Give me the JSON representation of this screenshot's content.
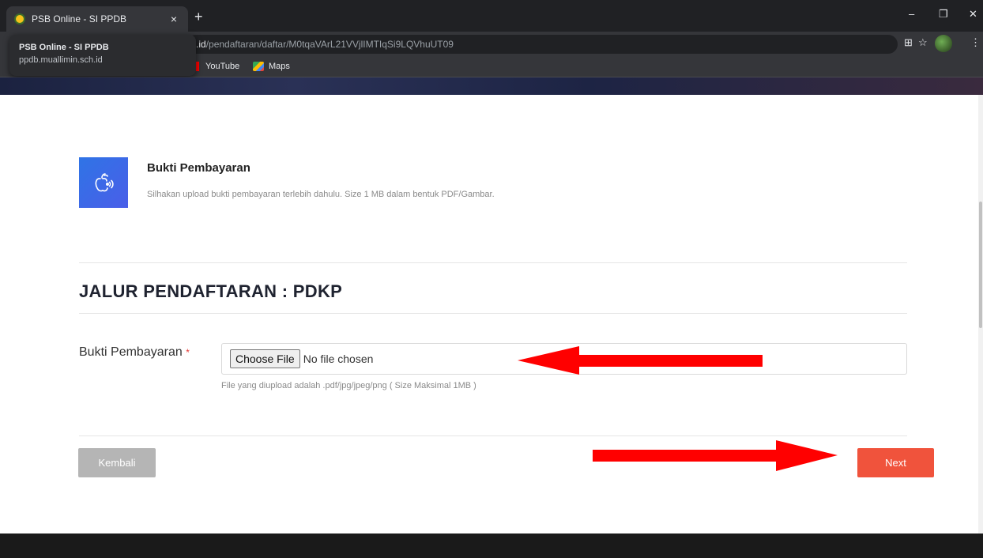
{
  "browser": {
    "tab_title": "PSB Online - SI PPDB",
    "tab_close": "×",
    "new_tab": "+",
    "url_host": ".id",
    "url_path": "/pendaftaran/daftar/M0tqaVArL21VVjlIMTIqSi9LQVhuUT09",
    "hover_card_title": "PSB Online - SI PPDB",
    "hover_card_domain": "ppdb.muallimin.sch.id",
    "bookmarks": [
      "YouTube",
      "Maps"
    ],
    "icons": {
      "minimize": "–",
      "restore": "❐",
      "close": "✕",
      "translate": "⊞",
      "star": "☆",
      "menu": "⋮"
    }
  },
  "step": {
    "title": "Bukti Pembayaran",
    "description": "Silhakan upload bukti pembayaran terlebih dahulu. Size 1 MB dalam bentuk PDF/Gambar.",
    "icon": "apple-signal-icon"
  },
  "section": {
    "heading": "JALUR PENDAFTARAN : PDKP"
  },
  "form": {
    "label": "Bukti Pembayaran",
    "required_mark": "*",
    "choose_file_label": "Choose File",
    "no_file_text": "No file chosen",
    "help_text": "File yang diupload adalah .pdf/jpg/jpeg/png ( Size Maksimal 1MB )"
  },
  "buttons": {
    "back": "Kembali",
    "next": "Next"
  },
  "colors": {
    "accent": "#f0533c",
    "icon_bg": "#3b6ae6",
    "annotation_arrow": "#ff0000"
  }
}
